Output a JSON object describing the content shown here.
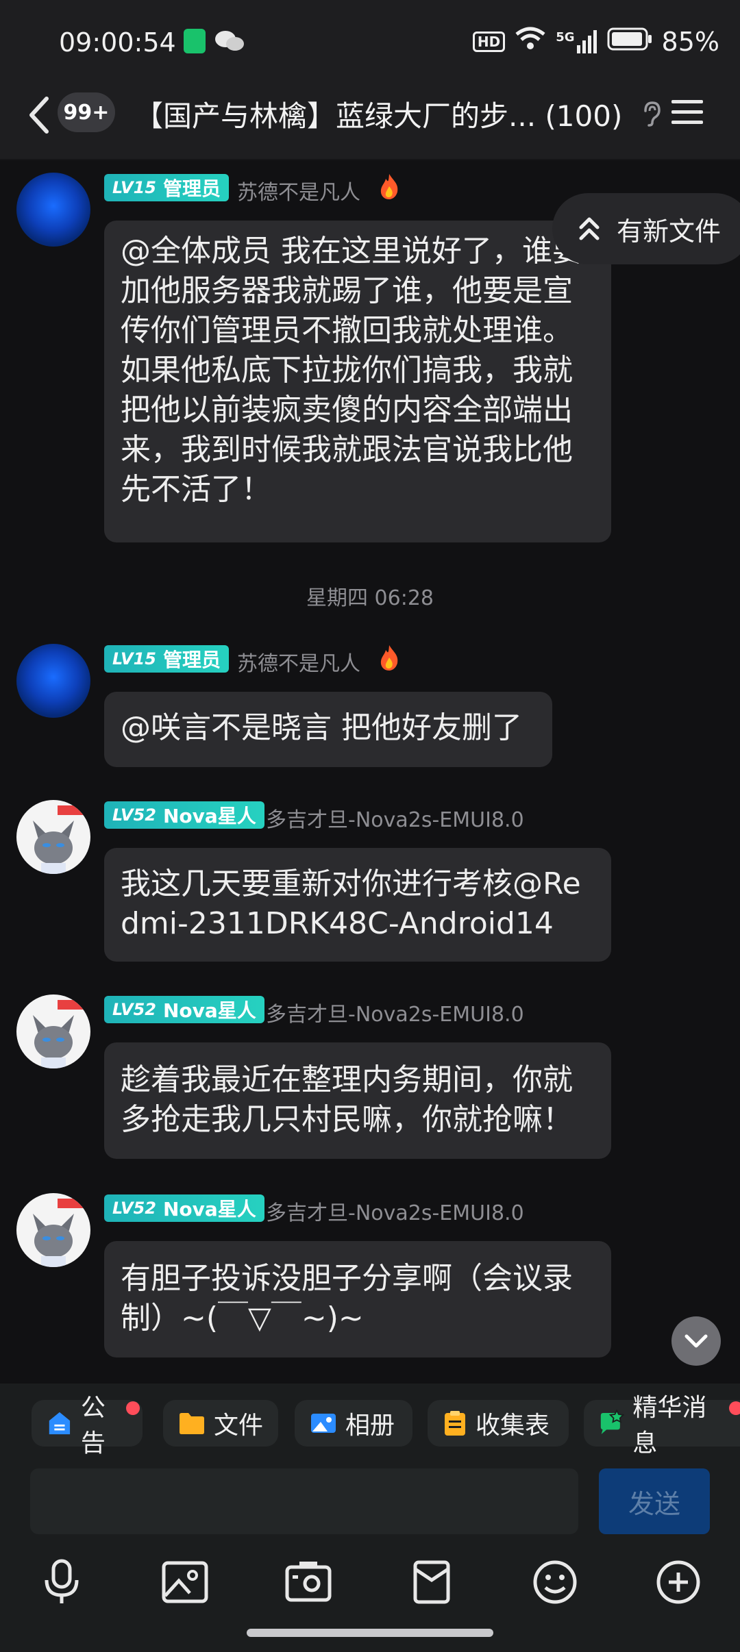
{
  "status_bar": {
    "time": "09:00:54",
    "battery": "85%",
    "hd": "HD",
    "network": "5G"
  },
  "header": {
    "badge": "99+",
    "title": "【国产与林檎】蓝绿大厂的步... (100)"
  },
  "new_file_pill": {
    "label": "有新文件"
  },
  "messages": [
    {
      "level": "LV15",
      "role": "管理员",
      "name": "苏德不是凡人",
      "text": "@全体成员 我在这里说好了，谁要加他服务器我就踢了谁，他要是宣传你们管理员不撤回我就处理谁。如果他私底下拉拢你们搞我，我就把他以前装疯卖傻的内容全部端出来，我到时候我就跟法官说我比他先不活了！"
    },
    {
      "level": "LV15",
      "role": "管理员",
      "name": "苏德不是凡人",
      "text": "@咲言不是晓言 把他好友删了"
    },
    {
      "level": "LV52",
      "role": "Nova星人",
      "name": "多吉才旦-Nova2s-EMUI8.0",
      "text": "我这几天要重新对你进行考核@Redmi-2311DRK48C-Android14"
    },
    {
      "level": "LV52",
      "role": "Nova星人",
      "name": "多吉才旦-Nova2s-EMUI8.0",
      "text": "趁着我最近在整理内务期间，你就多抢走我几只村民嘛，你就抢嘛！"
    },
    {
      "level": "LV52",
      "role": "Nova星人",
      "name": "多吉才旦-Nova2s-EMUI8.0",
      "text": "有胆子投诉没胆子分享啊（会议录制）~(￣▽￣~)~"
    }
  ],
  "time_separator": "星期四 06:28",
  "toolbar": {
    "announcement": "公告",
    "files": "文件",
    "album": "相册",
    "form": "收集表",
    "featured": "精华消息"
  },
  "input": {
    "send_label": "发送"
  },
  "colors": {
    "background": "#111113",
    "bubble": "#2b2b2e",
    "level_badge": "#22c3bd",
    "send_button": "#0d3c78",
    "notification_dot": "#ff4d5a"
  }
}
